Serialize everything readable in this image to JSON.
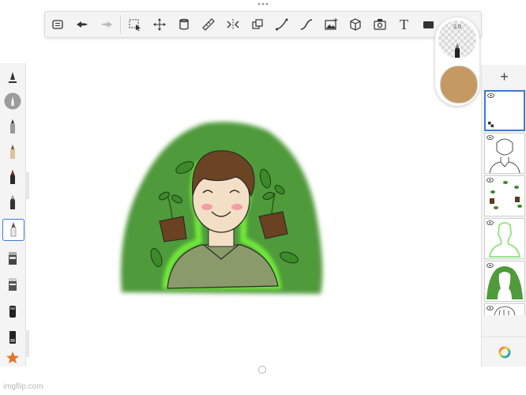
{
  "top_toolbar": {
    "tools": [
      {
        "name": "layers-menu-icon"
      },
      {
        "name": "undo-icon"
      },
      {
        "name": "redo-icon"
      },
      {
        "name": "selection-icon"
      },
      {
        "name": "transform-icon"
      },
      {
        "name": "fill-icon"
      },
      {
        "name": "ruler-icon"
      },
      {
        "name": "symmetry-icon"
      },
      {
        "name": "perspective-icon"
      },
      {
        "name": "stroke-icon"
      },
      {
        "name": "curve-icon"
      },
      {
        "name": "image-icon"
      },
      {
        "name": "3d-icon"
      },
      {
        "name": "import-icon"
      },
      {
        "name": "text-icon",
        "glyph": "T"
      },
      {
        "name": "frame-icon"
      }
    ]
  },
  "left_toolbar": {
    "tools": [
      "brush-settings-icon",
      "brush-preview-icon",
      "pencil-icon",
      "ink-pen-icon",
      "marker-icon",
      "airbrush-icon",
      "eraser-icon",
      "smudge-icon",
      "blend-icon",
      "felt-pen-icon",
      "chisel-marker-icon",
      "star-icon"
    ],
    "selected_index": 4
  },
  "color_puck": {
    "brush_size_label": "2.0",
    "current_color": "#c59a62"
  },
  "layers_panel": {
    "add_label": "+",
    "layers": [
      {
        "name": "empty-layer",
        "selected": true
      },
      {
        "name": "lineart-layer"
      },
      {
        "name": "leaves-layer"
      },
      {
        "name": "glow-layer"
      },
      {
        "name": "background-layer"
      },
      {
        "name": "hair-sketch-layer"
      }
    ]
  },
  "colors": {
    "accent": "#3a7bd5",
    "hair": "#6b4424",
    "skin": "#f3dfc6",
    "shirt": "#8b9a6a",
    "bg_green": "#4f9a3a"
  },
  "watermark": "imgflip.com"
}
